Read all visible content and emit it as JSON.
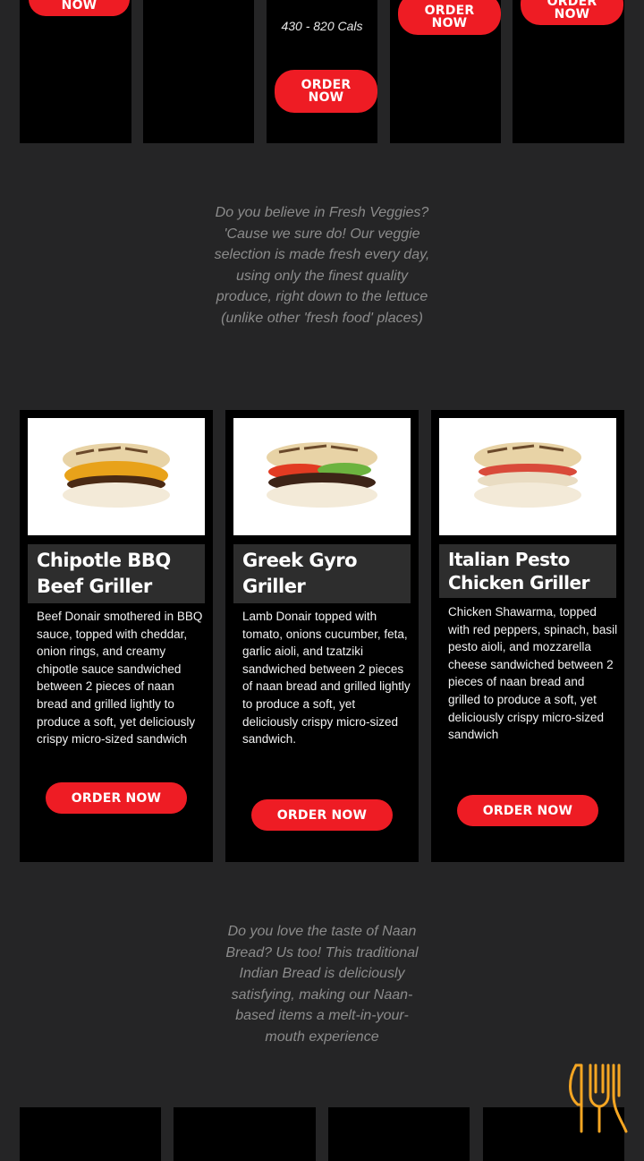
{
  "top_row": {
    "card1_button_partial": "NOW",
    "card3_calories": "430 - 820 Cals",
    "card3_button": [
      "ORDER",
      "NOW"
    ],
    "card4_button": [
      "ORDER",
      "NOW"
    ],
    "card5_button_partial": [
      "ORDER",
      "NOW"
    ]
  },
  "veggies_blurb": "Do you believe in Fresh Veggies? 'Cause we sure do! Our veggie selection is made fresh every day, using only the finest quality produce, right down to the lettuce (unlike other 'fresh food' places)",
  "products": [
    {
      "title": "Chipotle BBQ Beef Griller",
      "description": "Beef Donair smothered in BBQ sauce, topped with cheddar, onion rings, and creamy chipotle sauce sandwiched between 2 pieces of naan bread and grilled lightly to produce a soft, yet deliciously crispy micro-sized sandwich",
      "button": "ORDER NOW"
    },
    {
      "title": "Greek Gyro Griller",
      "description": "Lamb Donair topped with tomato, onions cucumber, feta, garlic aioli, and tzatziki sandwiched between 2 pieces of naan bread and grilled lightly to produce a soft, yet deliciously crispy micro-sized sandwich.",
      "button": "ORDER NOW"
    },
    {
      "title": "Italian Pesto Chicken Griller",
      "description": "Chicken Shawarma, topped with red peppers, spinach, basil pesto aioli, and mozzarella cheese sandwiched between 2 pieces of naan bread and grilled to produce a soft, yet deliciously crispy micro-sized sandwich",
      "button": "ORDER NOW"
    }
  ],
  "naan_blurb": "Do you love the taste of Naan Bread? Us too! This traditional Indian Bread is deliciously satisfying, making our Naan-based items a melt-in-your-mouth experience",
  "colors": {
    "accent": "#ee1c24",
    "logo": "#f5a623",
    "background": "#252526"
  },
  "icons": {
    "corner_logo": "fork-knife-icon"
  }
}
